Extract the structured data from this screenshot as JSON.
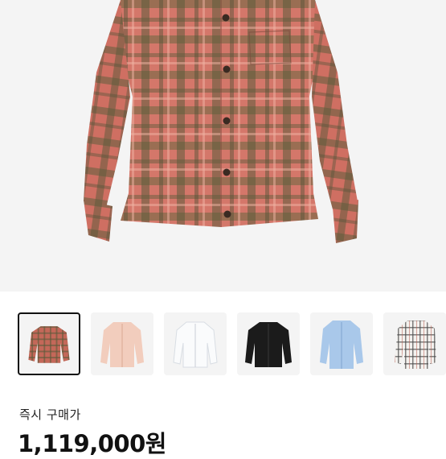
{
  "product": {
    "main_image": "plaid-shirt-red-green-photo",
    "thumbnails": [
      {
        "name": "plaid-red-green",
        "color": "#b55a4c",
        "selected": true
      },
      {
        "name": "blush-pink",
        "color": "#f2cdbd",
        "selected": false
      },
      {
        "name": "white",
        "color": "#f5f5f6",
        "selected": false
      },
      {
        "name": "black",
        "color": "#1b1b1b",
        "selected": false
      },
      {
        "name": "light-blue",
        "color": "#a9c8ea",
        "selected": false
      },
      {
        "name": "plaid-white-grey",
        "color": "#e8e6e2",
        "selected": false
      }
    ],
    "label": "즉시 구매가",
    "price": "1,119,000원"
  },
  "colors": {
    "plaid_red": "#c8675a",
    "plaid_green": "#5b5a3c",
    "background": "#f4f4f4"
  }
}
